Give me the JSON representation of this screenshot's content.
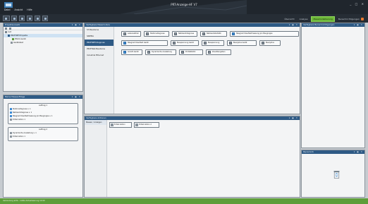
{
  "titlebar": {
    "title": "PRT-Anzeige-HF  V7",
    "menu": [
      "Datei",
      "Ansicht",
      "Hilfe"
    ],
    "window_controls": "_ □ ✕"
  },
  "toolbar": {
    "right_tabs": [
      {
        "label": "Übersicht",
        "active": false
      },
      {
        "label": "Analyse",
        "active": false
      },
      {
        "label": "Messmodellierung",
        "active": true
      },
      {
        "label": "Benachrichtigungen",
        "active": false
      }
    ]
  },
  "project_panel": {
    "title": "Projektauswahl",
    "nodes": [
      {
        "label": "root",
        "level": 0,
        "selected": false
      },
      {
        "label": "PROFINET-Projekte",
        "level": 1,
        "selected": true
      },
      {
        "label": "PN-IO-Gerät",
        "level": 2,
        "selected": false
      },
      {
        "label": "Gerätetest",
        "level": 2,
        "selected": false
      }
    ]
  },
  "library_panel": {
    "title": "Verfügbare Messmodule",
    "categories": [
      {
        "label": "S7-Bausteine",
        "selected": false
      },
      {
        "label": "SINEMA",
        "selected": false
      },
      {
        "label": "PROFINET-Diagnose",
        "selected": true
      },
      {
        "label": "PROFINet-Bausteine",
        "selected": false
      },
      {
        "label": "Industrial Ethernet",
        "selected": false
      }
    ],
    "blocks": [
      "Lebenszähler",
      "Stationsdiagnose",
      "Netzwerkdiagnose",
      "Netzwerkstatistik",
      "Telegrammlaufzeitmessung pro Baugruppe",
      "Telegrammlaufzeit Gerät",
      "Busspannung Gerät",
      "Busspannung",
      "Buszyklus Gerät",
      "Buszyklus",
      "Anzahl Gerät",
      "Dynamische Auslastung",
      "Portstatistik",
      "Zusatzangaben"
    ]
  },
  "instances_panel": {
    "title": "Verfügbare Aktionen",
    "list_item": "Messen / Anzeigen",
    "chips": [
      "E-Mail Aktion",
      "E-Mail Aktion 2"
    ]
  },
  "measure_panel": {
    "title": "Meine Messaufträge",
    "groups": [
      {
        "title": "Auftrag 1",
        "rows": [
          {
            "label": "Stationsdiagnose v. 1",
            "blue": true
          },
          {
            "label": "Netzwerkdiagnose v. 1",
            "blue": true
          },
          {
            "label": "Telegrammlaufzeitmessung pro Baugruppe v. 1",
            "blue": true
          },
          {
            "label": "E-Mail Aktion 1",
            "blue": false
          }
        ]
      },
      {
        "title": "Auftrag 2",
        "rows": [
          {
            "label": "Dynamische Auslastung v. 1",
            "blue": false
          },
          {
            "label": "E-Mail Aktion 1",
            "blue": false
          }
        ]
      }
    ]
  },
  "notifications_panel": {
    "title": "Verfügbare Benachrichtigungen"
  },
  "recycle_panel": {
    "title": "Papierkorb"
  },
  "status": {
    "text": "Verbindung aktiv · letzte Aktualisierung 12:00"
  },
  "colors": {
    "accent": "#2e5a85",
    "active_tab": "#6fba3a",
    "status": "#5e9e3a",
    "badge": "#e8782d"
  }
}
